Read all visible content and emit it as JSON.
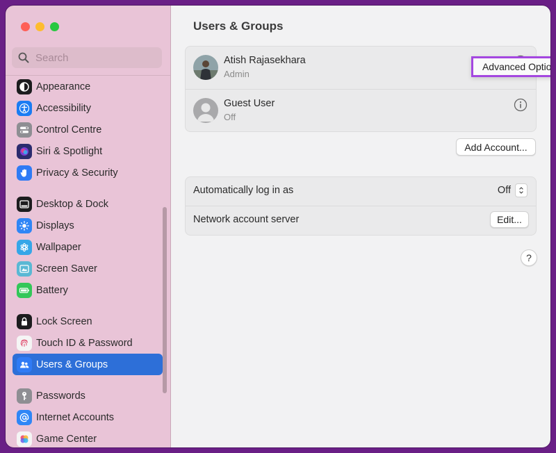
{
  "sidebar": {
    "search_placeholder": "Search",
    "groups": [
      [
        {
          "label": "Appearance",
          "icon": "appearance-icon",
          "color": "#1c1c1e"
        },
        {
          "label": "Accessibility",
          "icon": "accessibility-icon",
          "color": "#1a7cf3"
        },
        {
          "label": "Control Centre",
          "icon": "control-centre-icon",
          "color": "#8e8e93"
        },
        {
          "label": "Siri & Spotlight",
          "icon": "siri-icon",
          "color": "#2b2b6e"
        },
        {
          "label": "Privacy & Security",
          "icon": "hand-icon",
          "color": "#2f7bf5"
        }
      ],
      [
        {
          "label": "Desktop & Dock",
          "icon": "dock-icon",
          "color": "#1c1c1e"
        },
        {
          "label": "Displays",
          "icon": "sun-icon",
          "color": "#2f86f6"
        },
        {
          "label": "Wallpaper",
          "icon": "flower-icon",
          "color": "#35a6e8"
        },
        {
          "label": "Screen Saver",
          "icon": "screen-saver-icon",
          "color": "#5ab8d4"
        },
        {
          "label": "Battery",
          "icon": "battery-icon",
          "color": "#33c759"
        }
      ],
      [
        {
          "label": "Lock Screen",
          "icon": "lock-icon",
          "color": "#1c1c1e"
        },
        {
          "label": "Touch ID & Password",
          "icon": "fingerprint-icon",
          "color": "#f5f5f5"
        },
        {
          "label": "Users & Groups",
          "icon": "users-icon",
          "color": "#2f7bf5"
        }
      ],
      [
        {
          "label": "Passwords",
          "icon": "key-icon",
          "color": "#8e8e93"
        },
        {
          "label": "Internet Accounts",
          "icon": "at-icon",
          "color": "#2f86f6"
        },
        {
          "label": "Game Center",
          "icon": "game-center-icon",
          "color": "#f5f5f5"
        }
      ]
    ],
    "selected": "Users & Groups"
  },
  "main": {
    "title": "Users & Groups",
    "users": [
      {
        "name": "Atish Rajasekhara",
        "role": "Admin"
      },
      {
        "name": "Guest User",
        "role": "Off"
      }
    ],
    "popup_label": "Advanced Options...",
    "add_account_label": "Add Account...",
    "settings": {
      "auto_login_label": "Automatically log in as",
      "auto_login_value": "Off",
      "network_label": "Network account server",
      "edit_label": "Edit..."
    },
    "help_label": "?"
  },
  "colors": {
    "sidebar_bg": "#e9c4d7",
    "selection": "#2d6fd8",
    "popup_highlight": "#a447e0",
    "frame": "#6a1f86"
  }
}
